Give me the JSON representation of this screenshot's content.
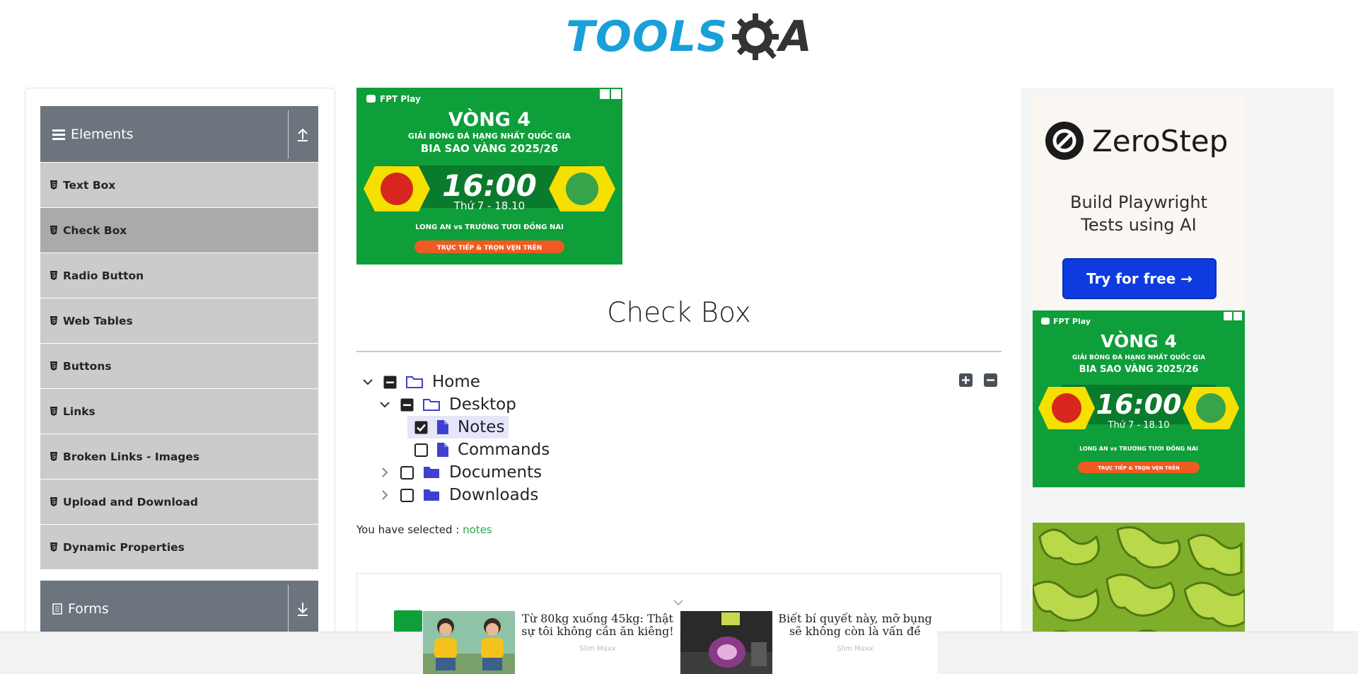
{
  "header": {
    "logo_tools": "TOOLS",
    "logo_qa": "A"
  },
  "sidebar": {
    "groups": [
      {
        "label": "Elements",
        "expanded": true
      },
      {
        "label": "Forms",
        "expanded": false
      }
    ],
    "items": [
      {
        "label": "Text Box"
      },
      {
        "label": "Check Box",
        "active": true
      },
      {
        "label": "Radio Button"
      },
      {
        "label": "Web Tables"
      },
      {
        "label": "Buttons"
      },
      {
        "label": "Links"
      },
      {
        "label": "Broken Links - Images"
      },
      {
        "label": "Upload and Download"
      },
      {
        "label": "Dynamic Properties"
      }
    ]
  },
  "main": {
    "title": "Check Box",
    "tree": {
      "home": "Home",
      "desktop": "Desktop",
      "notes": "Notes",
      "commands": "Commands",
      "documents": "Documents",
      "downloads": "Downloads"
    },
    "result_label": "You have selected :",
    "result_value": "notes"
  },
  "ads": {
    "fpt": {
      "brand": "FPT Play",
      "round": "VÒNG 4",
      "league": "GIẢI BÓNG ĐÁ HẠNG NHẤT QUỐC GIA",
      "cup": "BIA SAO VÀNG 2025/26",
      "time": "16:00",
      "date": "Thứ 7 - 18.10",
      "match": "LONG AN vs TRƯỜNG TƯƠI ĐỒNG NAI",
      "cta": "TRỰC TIẾP & TRỌN VẸN TRÊN",
      "team_left": "LONG AN"
    },
    "zerostep": {
      "name": "ZeroStep",
      "tagline_1": "Build Playwright",
      "tagline_2": "Tests using AI",
      "button": "Try for free →"
    },
    "promos": [
      {
        "text": "Từ 80kg xuống 45kg: Thật sự tôi không cần ăn kiêng!",
        "source": "Slim Maxx"
      },
      {
        "text": "Biết bí quyết này, mỡ bụng sẽ không còn là vấn đề",
        "source": "Slim Maxx"
      }
    ]
  },
  "colors": {
    "accent_blue": "#1aa0d8",
    "sidebar_header": "#6c757d",
    "menu_bg": "#cbcbcb",
    "menu_active": "#aaaaaa",
    "checkbox_folder": "#3f3fd0",
    "result_green": "#28a745"
  }
}
